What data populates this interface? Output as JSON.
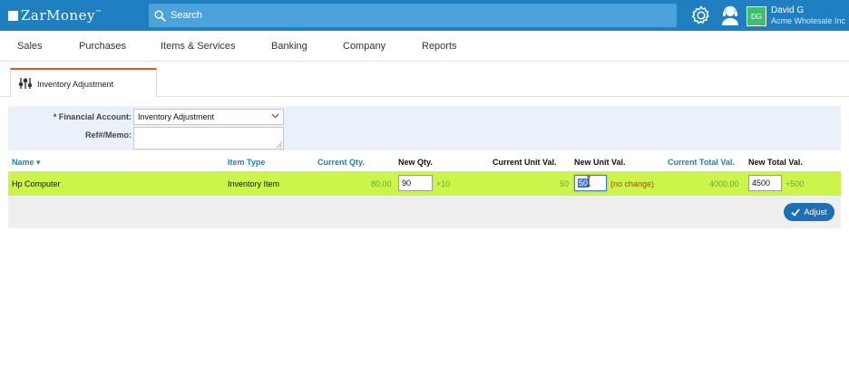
{
  "app": {
    "logo_text": "ZarMoney",
    "logo_tm": "™"
  },
  "search": {
    "placeholder": "Search"
  },
  "user": {
    "initials": "DG",
    "name": "David G",
    "company": "Acme Wholesale Inc"
  },
  "nav": {
    "items": [
      "Sales",
      "Purchases",
      "Items & Services",
      "Banking",
      "Company",
      "Reports"
    ]
  },
  "tab": {
    "label": "Inventory Adjustment"
  },
  "form": {
    "financial_account_label": "* Financial Account:",
    "financial_account_value": "Inventory Adjustment",
    "memo_label": "Ref#/Memo:",
    "memo_value": ""
  },
  "table": {
    "headers": {
      "name": "Name ▾",
      "item_type": "Item Type",
      "current_qty": "Current Qty.",
      "new_qty": "New Qty.",
      "current_unit_val": "Current Unit Val.",
      "new_unit_val": "New Unit Val.",
      "current_total_val": "Current Total Val.",
      "new_total_val": "New Total Val."
    },
    "rows": [
      {
        "name": "Hp Computer",
        "item_type": "Inventory Item",
        "current_qty": "80.00",
        "new_qty": "90",
        "qty_delta": "+10",
        "current_unit_val": "50",
        "new_unit_val": "50",
        "unit_note": "(no change)",
        "current_total_val": "4000.00",
        "new_total_val": "4500",
        "total_delta": "+500"
      }
    ]
  },
  "actions": {
    "adjust_label": "Adjust"
  },
  "colors": {
    "topbar": "#1f7fc1",
    "row_highlight": "#ccf44a",
    "tab_accent": "#e8551e",
    "delta_green": "#67a944",
    "note_red": "#c03b20"
  },
  "icons": [
    "search-icon",
    "gear-icon",
    "user-support-icon",
    "sliders-icon",
    "chevron-down-icon",
    "check-icon"
  ]
}
